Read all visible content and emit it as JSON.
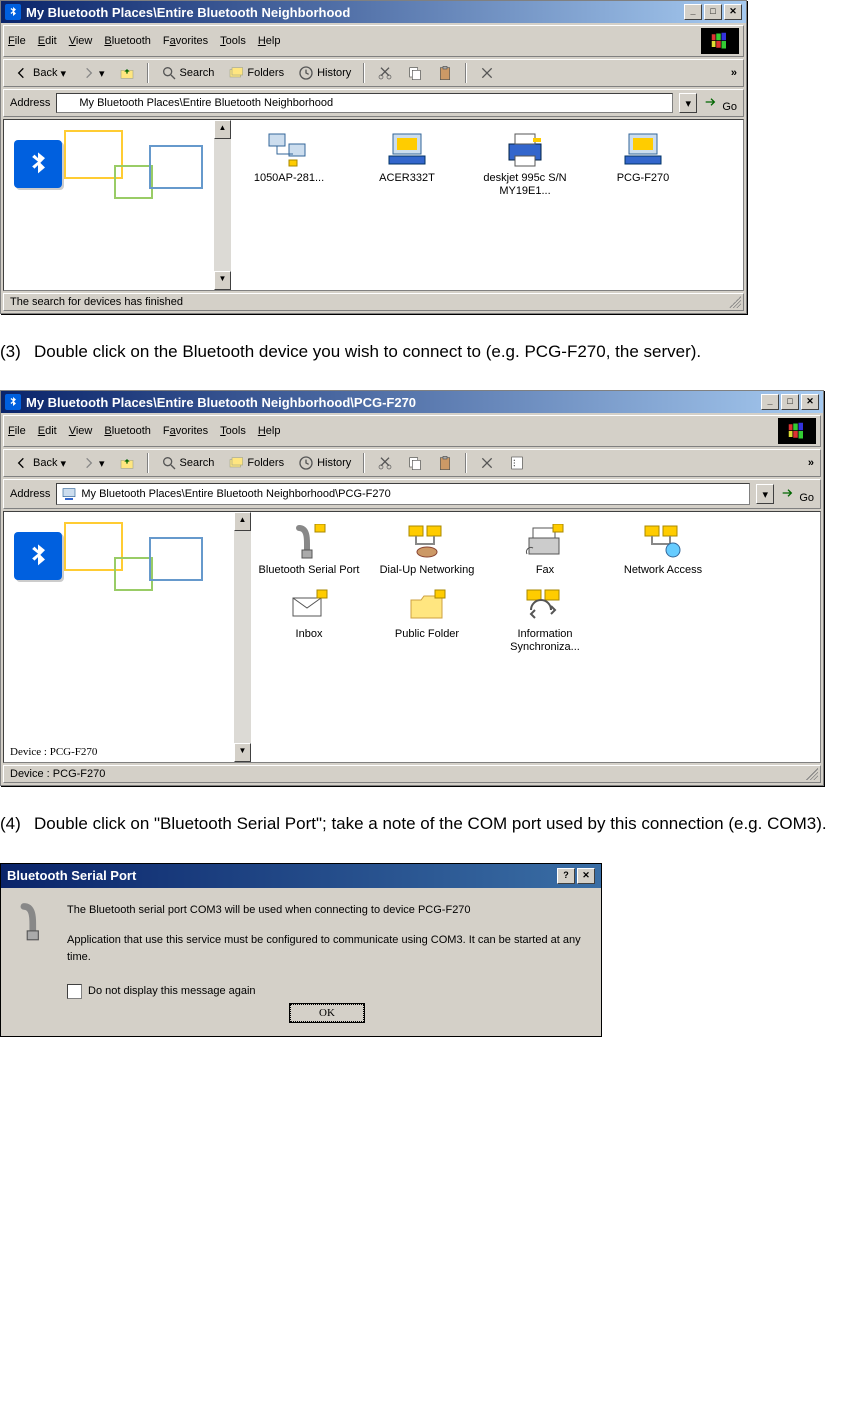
{
  "window1": {
    "title": "My Bluetooth Places\\Entire Bluetooth Neighborhood",
    "menu": [
      "File",
      "Edit",
      "View",
      "Bluetooth",
      "Favorites",
      "Tools",
      "Help"
    ],
    "menu_underline_idx": [
      0,
      0,
      0,
      0,
      1,
      0,
      0
    ],
    "toolbar": {
      "back": "Back",
      "search": "Search",
      "folders": "Folders",
      "history": "History"
    },
    "address_label": "Address",
    "address_value": "My Bluetooth Places\\Entire Bluetooth Neighborhood",
    "go": "Go",
    "status": "The search for devices has finished",
    "devices": [
      {
        "label": "1050AP-281..."
      },
      {
        "label": "ACER332T"
      },
      {
        "label": "deskjet 995c S/N MY19E1..."
      },
      {
        "label": "PCG-F270"
      }
    ]
  },
  "step3": {
    "num": "(3)",
    "text": "Double click on the Bluetooth device you wish to connect to (e.g. PCG-F270, the server)."
  },
  "window2": {
    "title": "My Bluetooth Places\\Entire Bluetooth Neighborhood\\PCG-F270",
    "menu": [
      "File",
      "Edit",
      "View",
      "Bluetooth",
      "Favorites",
      "Tools",
      "Help"
    ],
    "menu_underline_idx": [
      0,
      0,
      0,
      0,
      1,
      0,
      0
    ],
    "toolbar": {
      "back": "Back",
      "search": "Search",
      "folders": "Folders",
      "history": "History"
    },
    "address_label": "Address",
    "address_value": "My Bluetooth Places\\Entire Bluetooth Neighborhood\\PCG-F270",
    "go": "Go",
    "side_caption": "Device : PCG-F270",
    "status": "Device : PCG-F270",
    "services": [
      {
        "label": "Bluetooth Serial Port"
      },
      {
        "label": "Dial-Up Networking"
      },
      {
        "label": "Fax"
      },
      {
        "label": "Network Access"
      },
      {
        "label": "Inbox"
      },
      {
        "label": "Public Folder"
      },
      {
        "label": "Information Synchroniza..."
      }
    ]
  },
  "step4": {
    "num": "(4)",
    "text": "Double click on \"Bluetooth Serial Port\"; take a note of the COM port used by this connection (e.g. COM3)."
  },
  "dialog": {
    "title": "Bluetooth Serial Port",
    "line1": "The Bluetooth serial port COM3 will be used when connecting to device PCG-F270",
    "line2": "Application that use this service must be configured to communicate using COM3.  It can be started at any time.",
    "checkbox": "Do not display this message again",
    "ok": "OK"
  }
}
